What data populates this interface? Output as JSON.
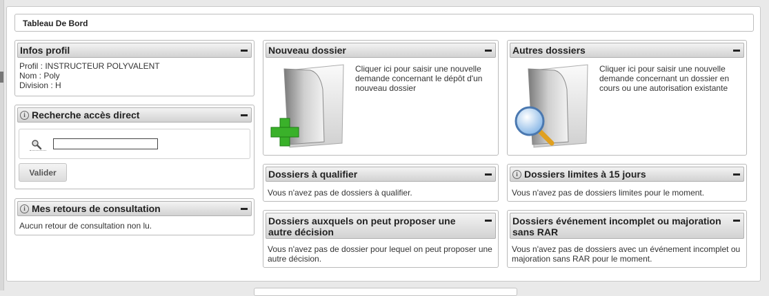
{
  "page": {
    "title": "Tableau De Bord"
  },
  "widgets": {
    "infos_profil": {
      "title": "Infos profil",
      "lines": [
        "Profil : INSTRUCTEUR POLYVALENT",
        "Nom : Poly",
        "Division : H"
      ]
    },
    "recherche": {
      "title": "Recherche accès direct",
      "input_value": "",
      "button_label": "Valider"
    },
    "retours": {
      "title": "Mes retours de consultation",
      "text": "Aucun retour de consultation non lu."
    },
    "nouveau_dossier": {
      "title": "Nouveau dossier",
      "text": "Cliquer ici pour saisir une nouvelle demande concernant le dépôt d'un nouveau dossier"
    },
    "autres_dossiers": {
      "title": "Autres dossiers",
      "text": "Cliquer ici pour saisir une nouvelle demande concernant un dossier en cours ou une autorisation existante"
    },
    "a_qualifier": {
      "title": "Dossiers à qualifier",
      "text": "Vous n'avez pas de dossiers à qualifier."
    },
    "limites": {
      "title": "Dossiers limites à 15 jours",
      "text": "Vous n'avez pas de dossiers limites pour le moment."
    },
    "autre_decision": {
      "title": "Dossiers auxquels on peut proposer une autre décision",
      "text": "Vous n'avez pas de dossier pour lequel on peut proposer une autre décision."
    },
    "incomplet": {
      "title": "Dossiers événement incomplet ou majoration sans RAR",
      "text": "Vous n'avez pas de dossiers avec un événement incomplet ou majoration sans RAR pour le moment."
    }
  },
  "icons": {
    "collapse": "minus-icon",
    "info": "info-icon",
    "search": "magnifier-icon",
    "new_folder": "folder-add-icon",
    "search_folder": "folder-search-icon"
  },
  "colors": {
    "plus_green": "#3ab12a",
    "header_gradient_top": "#f3f3f3",
    "header_gradient_bottom": "#d2d2d2"
  }
}
